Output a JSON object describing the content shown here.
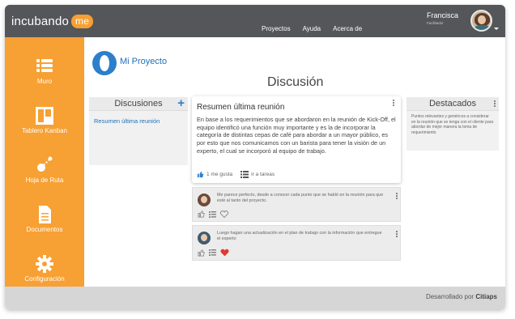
{
  "brand": {
    "name": "incubando",
    "badge": "me"
  },
  "nav": [
    "Proyectos",
    "Ayuda",
    "Acerca de"
  ],
  "user": {
    "name": "Francisca",
    "role": "Facilitador"
  },
  "sidebar": [
    {
      "label": "Muro",
      "icon": "list-icon"
    },
    {
      "label": "Tablero Kanban",
      "icon": "kanban-icon"
    },
    {
      "label": "Hoja de Ruta",
      "icon": "route-icon"
    },
    {
      "label": "Documentos",
      "icon": "document-icon"
    },
    {
      "label": "Configuración",
      "icon": "gear-icon"
    }
  ],
  "project": {
    "title": "Mi Proyecto"
  },
  "page": {
    "title": "Discusión"
  },
  "discussions": {
    "header": "Discusiones",
    "items": [
      "Resumen última reunión"
    ]
  },
  "summary": {
    "title": "Resumen última reunión",
    "body": "En base a los requerimientos que se abordaron en la reunión de Kick-Off, el equipo identificó una función muy importante y es la de incorporar la categoría de distintas cepas de café para abordar a un mayor público, es por esto que nos comunicamos con un barista para tener la visión de un experto, el cual se incorporó al equipo de trabajo.",
    "like_label": "1 me gusta",
    "tasks_label": "ir a tareas"
  },
  "comments": [
    {
      "text": "Me parece perfecto, desde a conocer cada punto que se habló en la reunión para que esté al tanto del proyecto.",
      "liked": false
    },
    {
      "text": "Luego hagan una actualización en el plan de trabajo con la información que entregue el experto",
      "liked": true
    }
  ],
  "highlights": {
    "header": "Destacados",
    "body": "Puntos relevantes y genéricos a considerar en la reunión que se tenga con el cliente para abordar de mejor manera la toma de requerimiento"
  },
  "footer": {
    "prefix": "Desarrollado por",
    "brand": "Citiaps"
  },
  "colors": {
    "accent": "#f7a033",
    "topbar": "#555659",
    "link": "#1f6fb8",
    "heart": "#e0392e"
  }
}
